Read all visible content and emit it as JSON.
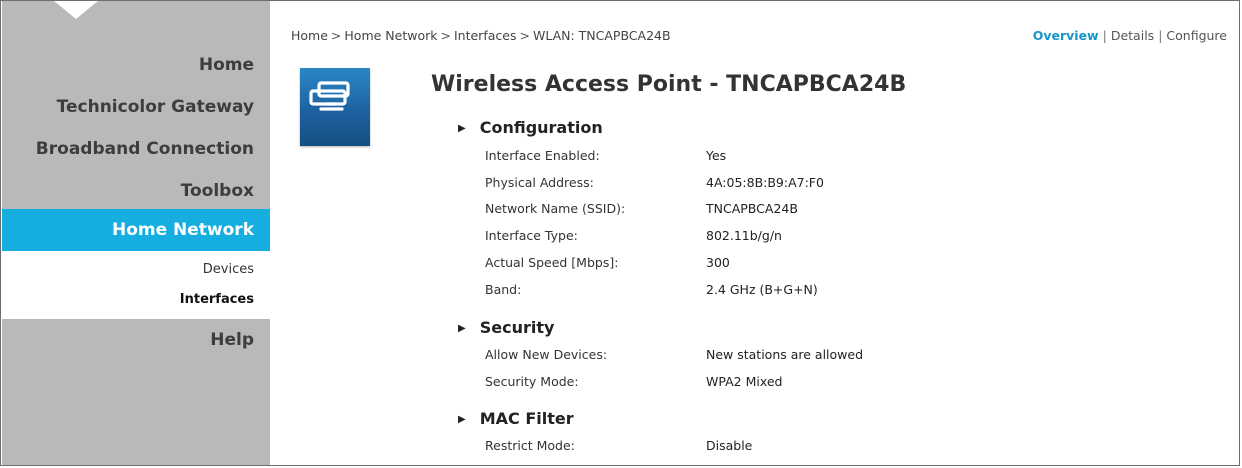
{
  "sidebar": {
    "items": [
      {
        "label": "Home"
      },
      {
        "label": "Technicolor Gateway"
      },
      {
        "label": "Broadband Connection"
      },
      {
        "label": "Toolbox"
      }
    ],
    "active": {
      "label": "Home Network"
    },
    "subitems": [
      {
        "label": "Devices"
      },
      {
        "label": "Interfaces"
      }
    ],
    "help": {
      "label": "Help"
    }
  },
  "breadcrumb": {
    "items": [
      "Home",
      "Home Network",
      "Interfaces",
      "WLAN: TNCAPBCA24B"
    ],
    "separator": ">"
  },
  "view_links": {
    "overview": "Overview",
    "details": "Details",
    "configure": "Configure",
    "divider": "|"
  },
  "page_title": "Wireless Access Point - TNCAPBCA24B",
  "icon": "wireless-access-point-icon",
  "accent_color": "#16aee1",
  "sections": [
    {
      "title": "Configuration",
      "rows": [
        {
          "label": "Interface Enabled:",
          "value": "Yes"
        },
        {
          "label": "Physical Address:",
          "value": "4A:05:8B:B9:A7:F0"
        },
        {
          "label": "Network Name (SSID):",
          "value": "TNCAPBCA24B"
        },
        {
          "label": "Interface Type:",
          "value": "802.11b/g/n"
        },
        {
          "label": "Actual Speed [Mbps]:",
          "value": "300"
        },
        {
          "label": "Band:",
          "value": "2.4 GHz (B+G+N)"
        }
      ]
    },
    {
      "title": "Security",
      "rows": [
        {
          "label": "Allow New Devices:",
          "value": "New stations are allowed"
        },
        {
          "label": "Security Mode:",
          "value": "WPA2 Mixed"
        }
      ]
    },
    {
      "title": "MAC Filter",
      "rows": [
        {
          "label": "Restrict Mode:",
          "value": "Disable"
        }
      ]
    }
  ]
}
